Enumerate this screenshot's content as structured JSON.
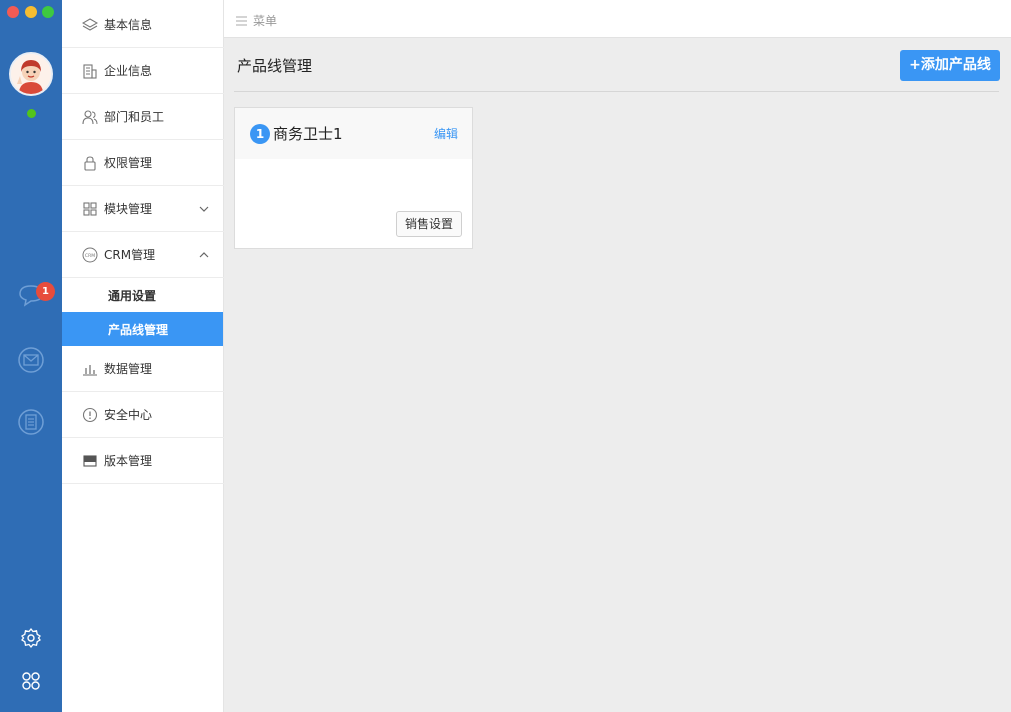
{
  "window": {
    "controls": [
      "close",
      "minimize",
      "maximize"
    ]
  },
  "rail": {
    "avatar_icon": "user-avatar",
    "status": "online",
    "items": [
      {
        "icon": "chat-icon",
        "badge": "1"
      },
      {
        "icon": "mail-icon"
      },
      {
        "icon": "notes-icon"
      }
    ],
    "bottom": [
      {
        "icon": "gear-icon"
      },
      {
        "icon": "apps-grid-icon"
      }
    ]
  },
  "nav": {
    "items": [
      {
        "label": "基本信息",
        "icon": "layers-icon"
      },
      {
        "label": "企业信息",
        "icon": "building-icon"
      },
      {
        "label": "部门和员工",
        "icon": "users-icon"
      },
      {
        "label": "权限管理",
        "icon": "lock-icon"
      },
      {
        "label": "模块管理",
        "icon": "modules-icon",
        "expanded": false
      },
      {
        "label": "CRM管理",
        "icon": "crm-icon",
        "expanded": true
      },
      {
        "label": "数据管理",
        "icon": "bar-chart-icon"
      },
      {
        "label": "安全中心",
        "icon": "alert-icon"
      },
      {
        "label": "版本管理",
        "icon": "version-icon"
      }
    ],
    "crm_subitems": [
      {
        "label": "通用设置",
        "active": false
      },
      {
        "label": "产品线管理",
        "active": true
      }
    ]
  },
  "topbar": {
    "menu_label": "菜单"
  },
  "main": {
    "title": "产品线管理",
    "add_button": "+添加产品线",
    "cards": [
      {
        "index": "1",
        "name": "商务卫士1",
        "edit_label": "编辑",
        "action_label": "销售设置"
      }
    ]
  },
  "colors": {
    "rail_bg": "#2f6db5",
    "accent": "#3a96f4",
    "badge": "#e74c3c",
    "online": "#52c41a"
  }
}
